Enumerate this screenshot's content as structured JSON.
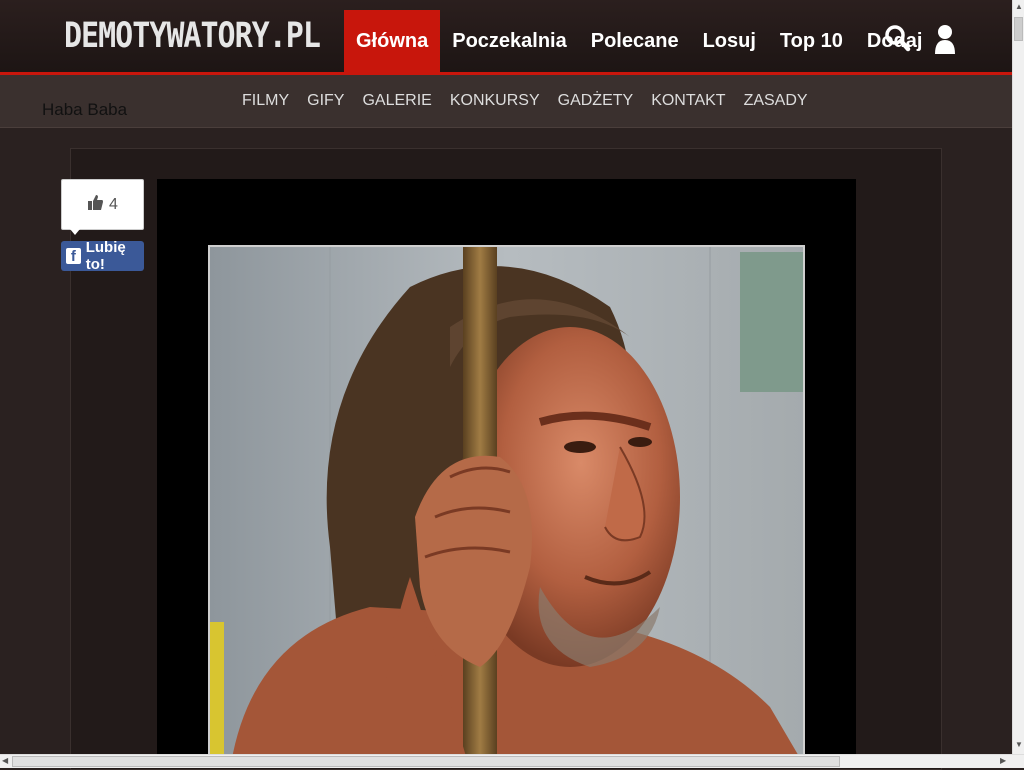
{
  "header": {
    "logo": "DEMOTYWATORY.PL",
    "nav": [
      {
        "label": "Główna",
        "active": true
      },
      {
        "label": "Poczekalnia"
      },
      {
        "label": "Polecane"
      },
      {
        "label": "Losuj"
      },
      {
        "label": "Top 10"
      },
      {
        "label": "Dodaj"
      }
    ],
    "icons": [
      "search-icon",
      "user-icon"
    ],
    "accent_color": "#c8160c"
  },
  "subheader": {
    "username": "Haba Baba",
    "nav": [
      "FILMY",
      "GIFY",
      "GALERIE",
      "KONKURSY",
      "GADŻETY",
      "KONTAKT",
      "ZASADY"
    ]
  },
  "post": {
    "likes": "4",
    "like_button": "Lubię to!",
    "like_button_color": "#3b5998",
    "image_subject": "neanderthal man holding a wooden stick"
  }
}
